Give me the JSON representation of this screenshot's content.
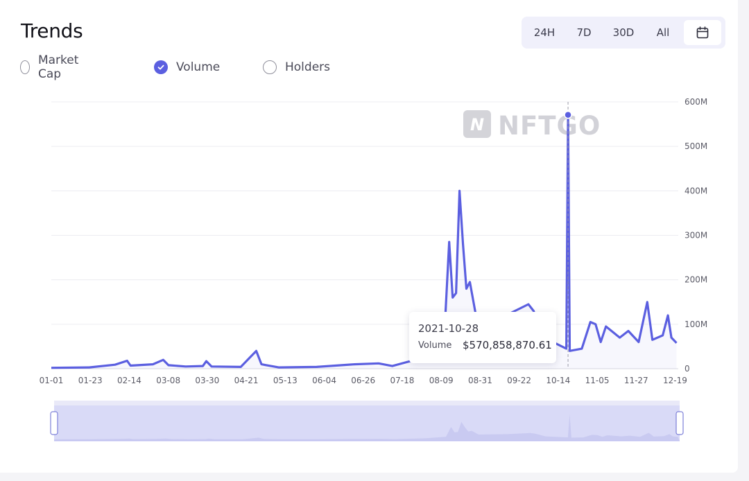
{
  "page": {
    "title": "Trends",
    "time_ranges": [
      "24H",
      "7D",
      "30D",
      "All"
    ],
    "calendar_icon": "calendar-icon",
    "metrics": [
      {
        "label": "Market Cap",
        "checked": false
      },
      {
        "label": "Volume",
        "checked": true
      },
      {
        "label": "Holders",
        "checked": false
      }
    ],
    "watermark": "NFTGO",
    "accent_color": "#5b5fe0"
  },
  "tooltip": {
    "date": "2021-10-28",
    "label": "Volume",
    "value": "$570,858,870.61"
  },
  "chart_data": {
    "type": "line",
    "xlabel": "",
    "ylabel": "",
    "x_ticks": [
      "01-01",
      "01-23",
      "02-14",
      "03-08",
      "03-30",
      "04-21",
      "05-13",
      "06-04",
      "06-26",
      "07-18",
      "08-09",
      "08-31",
      "09-22",
      "10-14",
      "11-05",
      "11-27",
      "12-19"
    ],
    "y_ticks": [
      "0",
      "100M",
      "200M",
      "300M",
      "400M",
      "500M",
      "600M"
    ],
    "ylim": [
      0,
      600000000
    ],
    "grid": "horizontal",
    "x_start": "2021-01-01",
    "x_end": "2021-12-31",
    "highlight": {
      "x": "2021-10-28",
      "y": 570858870.61
    },
    "series": [
      {
        "values": [
          [
            "2021-01-01",
            2000000
          ],
          [
            "2021-01-23",
            3000000
          ],
          [
            "2021-02-07",
            9000000
          ],
          [
            "2021-02-14",
            18000000
          ],
          [
            "2021-02-16",
            7000000
          ],
          [
            "2021-03-01",
            10000000
          ],
          [
            "2021-03-07",
            20000000
          ],
          [
            "2021-03-10",
            8000000
          ],
          [
            "2021-03-20",
            5000000
          ],
          [
            "2021-03-30",
            6000000
          ],
          [
            "2021-04-01",
            17000000
          ],
          [
            "2021-04-04",
            5000000
          ],
          [
            "2021-04-21",
            4000000
          ],
          [
            "2021-04-30",
            40000000
          ],
          [
            "2021-05-03",
            10000000
          ],
          [
            "2021-05-13",
            3000000
          ],
          [
            "2021-06-04",
            4000000
          ],
          [
            "2021-06-26",
            10000000
          ],
          [
            "2021-07-10",
            12000000
          ],
          [
            "2021-07-18",
            6000000
          ],
          [
            "2021-08-05",
            25000000
          ],
          [
            "2021-08-17",
            60000000
          ],
          [
            "2021-08-20",
            285000000
          ],
          [
            "2021-08-22",
            160000000
          ],
          [
            "2021-08-24",
            170000000
          ],
          [
            "2021-08-26",
            400000000
          ],
          [
            "2021-08-28",
            280000000
          ],
          [
            "2021-08-30",
            180000000
          ],
          [
            "2021-09-01",
            195000000
          ],
          [
            "2021-09-05",
            110000000
          ],
          [
            "2021-09-22",
            120000000
          ],
          [
            "2021-10-05",
            145000000
          ],
          [
            "2021-10-08",
            130000000
          ],
          [
            "2021-10-14",
            70000000
          ],
          [
            "2021-10-27",
            45000000
          ],
          [
            "2021-10-28",
            570858870.61
          ],
          [
            "2021-10-29",
            40000000
          ],
          [
            "2021-11-05",
            45000000
          ],
          [
            "2021-11-10",
            105000000
          ],
          [
            "2021-11-13",
            100000000
          ],
          [
            "2021-11-16",
            60000000
          ],
          [
            "2021-11-19",
            95000000
          ],
          [
            "2021-11-27",
            70000000
          ],
          [
            "2021-12-02",
            85000000
          ],
          [
            "2021-12-08",
            60000000
          ],
          [
            "2021-12-13",
            150000000
          ],
          [
            "2021-12-16",
            65000000
          ],
          [
            "2021-12-22",
            75000000
          ],
          [
            "2021-12-25",
            120000000
          ],
          [
            "2021-12-27",
            70000000
          ],
          [
            "2021-12-30",
            58000000
          ]
        ]
      }
    ]
  }
}
